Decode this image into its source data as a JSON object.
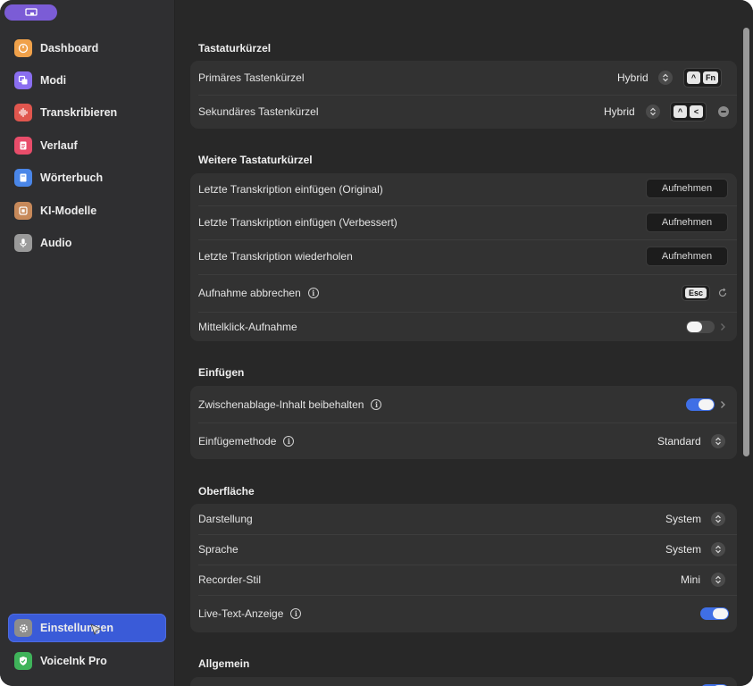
{
  "sidebar": {
    "items": [
      {
        "label": "Dashboard",
        "icon": "dashboard-gauge-icon",
        "color": "#f0a14a"
      },
      {
        "label": "Modi",
        "icon": "modes-icon",
        "color": "#8a6ef0"
      },
      {
        "label": "Transkribieren",
        "icon": "waveform-icon",
        "color": "#e0564e"
      },
      {
        "label": "Verlauf",
        "icon": "document-icon",
        "color": "#e84d6a"
      },
      {
        "label": "Wörterbuch",
        "icon": "book-icon",
        "color": "#4a86e8"
      },
      {
        "label": "KI-Modelle",
        "icon": "chip-icon",
        "color": "#c7895a"
      },
      {
        "label": "Audio",
        "icon": "microphone-icon",
        "color": "#9a9a9a"
      }
    ],
    "bottom": [
      {
        "label": "Einstellungen",
        "icon": "gear-icon",
        "color": "#8d8d8d",
        "active": true
      },
      {
        "label": "VoiceInk Pro",
        "icon": "shield-check-icon",
        "color": "#3fb35a",
        "active": false
      }
    ]
  },
  "sections": {
    "shortcuts": {
      "title": "Tastaturkürzel",
      "primary": {
        "label": "Primäres Tastenkürzel",
        "mode": "Hybrid",
        "keys": [
          "^",
          "Fn"
        ]
      },
      "secondary": {
        "label": "Sekundäres Tastenkürzel",
        "mode": "Hybrid",
        "keys": [
          "^",
          "<"
        ]
      }
    },
    "more_shortcuts": {
      "title": "Weitere Tastaturkürzel",
      "rows": [
        {
          "label": "Letzte Transkription einfügen (Original)",
          "button": "Aufnehmen"
        },
        {
          "label": "Letzte Transkription einfügen (Verbessert)",
          "button": "Aufnehmen"
        },
        {
          "label": "Letzte Transkription wiederholen",
          "button": "Aufnehmen"
        }
      ],
      "cancel": {
        "label": "Aufnahme abbrechen",
        "key": "Esc"
      },
      "middle_click": {
        "label": "Mittelklick-Aufnahme",
        "on": false
      }
    },
    "paste": {
      "title": "Einfügen",
      "clipboard": {
        "label": "Zwischenablage-Inhalt beibehalten",
        "on": true
      },
      "method": {
        "label": "Einfügemethode",
        "value": "Standard"
      }
    },
    "ui": {
      "title": "Oberfläche",
      "appearance": {
        "label": "Darstellung",
        "value": "System"
      },
      "language": {
        "label": "Sprache",
        "value": "System"
      },
      "recorder": {
        "label": "Recorder-Stil",
        "value": "Mini"
      },
      "live_text": {
        "label": "Live-Text-Anzeige",
        "on": true
      }
    },
    "general": {
      "title": "Allgemein"
    }
  },
  "colors": {
    "accent": "#3f6fe6",
    "active_nav": "#3a5bd8"
  }
}
